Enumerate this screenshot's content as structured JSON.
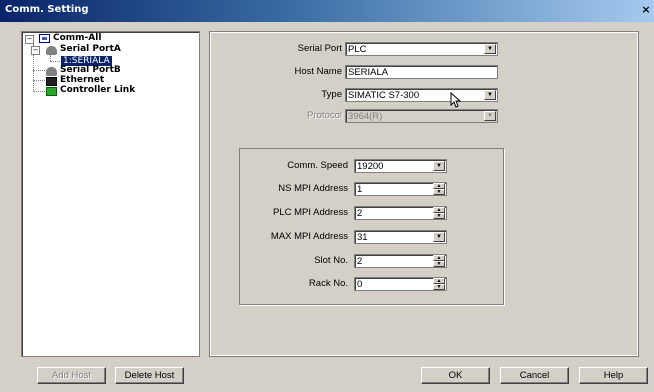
{
  "window": {
    "title": "Comm. Setting",
    "close_glyph": "×"
  },
  "tree": {
    "root": "Comm-All",
    "serial_a": "Serial PortA",
    "serial_a_child": "1:SERIALA",
    "serial_b": "Serial PortB",
    "ethernet": "Ethernet",
    "controller_link": "Controller Link",
    "expander_minus": "−"
  },
  "host": {
    "serial_port_label": "Serial Port",
    "serial_port_value": "PLC",
    "host_name_label": "Host Name",
    "host_name_value": "SERIALA",
    "type_label": "Type",
    "type_value": "SIMATIC S7-300",
    "protocol_label": "Protocol",
    "protocol_value": "3964(R)"
  },
  "settings": {
    "comm_speed_label": "Comm. Speed",
    "comm_speed_value": "19200",
    "ns_mpi_label": "NS MPI Address",
    "ns_mpi_value": "1",
    "plc_mpi_label": "PLC MPI Address",
    "plc_mpi_value": "2",
    "max_mpi_label": "MAX MPI Address",
    "max_mpi_value": "31",
    "slot_label": "Slot No.",
    "slot_value": "2",
    "rack_label": "Rack No.",
    "rack_value": "0"
  },
  "buttons": {
    "add_host": "Add Host",
    "delete_host": "Delete Host",
    "ok": "OK",
    "cancel": "Cancel",
    "help": "Help"
  },
  "glyphs": {
    "dropdown": "▼",
    "spin_up": "▲",
    "spin_down": "▼"
  }
}
